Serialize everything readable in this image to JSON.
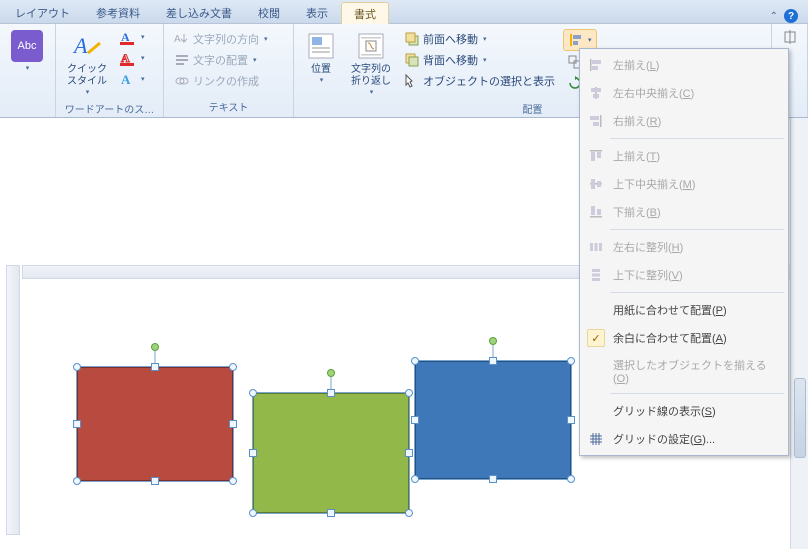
{
  "tabs": {
    "layout": "レイアウト",
    "references": "参考資料",
    "mailings": "差し込み文書",
    "review": "校閲",
    "view": "表示",
    "format": "書式"
  },
  "ribbon": {
    "abc_badge": "Abc",
    "quick_styles": "クイック\nスタイル",
    "wordart_styles_label": "ワードアートのス…",
    "text_direction": "文字列の方向",
    "text_alignment": "文字の配置",
    "create_link": "リンクの作成",
    "text_group": "テキスト",
    "position": "位置",
    "wrap_text": "文字列の\n折り返し",
    "bring_forward": "前面へ移動",
    "send_backward": "背面へ移動",
    "selection_pane": "オブジェクトの選択と表示",
    "arrange_group": "配置"
  },
  "menu": {
    "align_left": {
      "label": "左揃え",
      "accel": "L"
    },
    "align_center_h": {
      "label": "左右中央揃え",
      "accel": "C"
    },
    "align_right": {
      "label": "右揃え",
      "accel": "R"
    },
    "align_top": {
      "label": "上揃え",
      "accel": "T"
    },
    "align_middle_v": {
      "label": "上下中央揃え",
      "accel": "M"
    },
    "align_bottom": {
      "label": "下揃え",
      "accel": "B"
    },
    "dist_h": {
      "label": "左右に整列",
      "accel": "H"
    },
    "dist_v": {
      "label": "上下に整列",
      "accel": "V"
    },
    "align_to_page": {
      "label": "用紙に合わせて配置",
      "accel": "P"
    },
    "align_to_margin": {
      "label": "余白に合わせて配置",
      "accel": "A"
    },
    "align_selected": {
      "label": "選択したオブジェクトを揃える",
      "accel": "O"
    },
    "view_gridlines": {
      "label": "グリッド線の表示",
      "accel": "S"
    },
    "grid_settings": {
      "label": "グリッドの設定",
      "accel": "G",
      "suffix": "..."
    }
  },
  "shapes": {
    "colors": {
      "red": "#b94a3f",
      "green": "#92b84a",
      "blue": "#3f78b9"
    }
  }
}
